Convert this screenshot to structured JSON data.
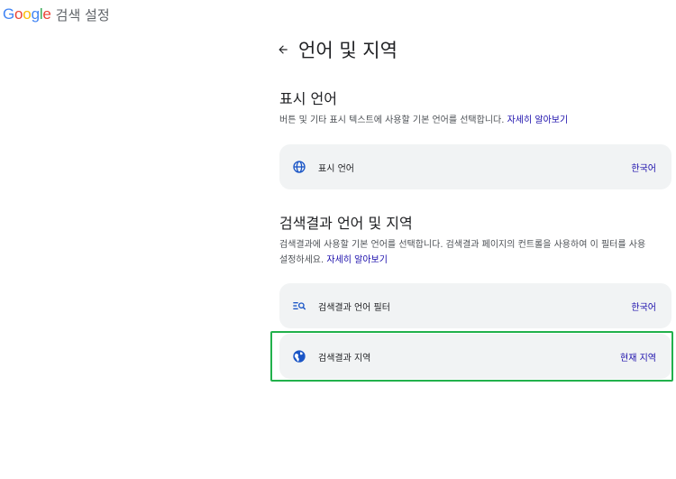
{
  "header": {
    "logo": [
      "G",
      "o",
      "o",
      "g",
      "l",
      "e"
    ],
    "logo_colors": [
      "#4285F4",
      "#EA4335",
      "#FBBC05",
      "#4285F4",
      "#34A853",
      "#EA4335"
    ],
    "title": "검색 설정"
  },
  "page": {
    "back_icon": "back-arrow-icon",
    "title": "언어 및 지역"
  },
  "display_language": {
    "heading": "표시 언어",
    "description": "버튼 및 기타 표시 텍스트에 사용할 기본 언어를 선택합니다.",
    "link": "자세히 알아보기",
    "card": {
      "icon": "globe-icon",
      "label": "표시 언어",
      "value": "한국어"
    }
  },
  "results_language": {
    "heading": "검색결과 언어 및 지역",
    "description_line1": "검색결과에 사용할 기본 언어를 선택합니다. 검색결과 페이지의 컨트롤을 사용하여 이 필터를 사용",
    "description_line2": "설정하세요.",
    "link": "자세히 알아보기",
    "filter_card": {
      "icon": "filter-search-icon",
      "label": "검색결과 언어 필터",
      "value": "한국어"
    },
    "region_card": {
      "icon": "globe-filled-icon",
      "label": "검색결과 지역",
      "value": "현재 지역"
    }
  },
  "colors": {
    "accent": "#1a0dab",
    "card_bg": "#f1f3f4",
    "highlight": "#22b14c",
    "icon_blue": "#1a55c6"
  }
}
